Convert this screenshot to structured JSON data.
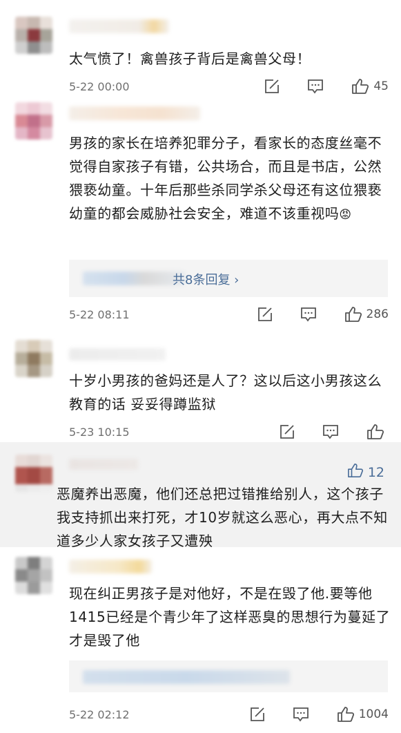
{
  "comments": [
    {
      "text": "太气愤了！禽兽孩子背后是禽兽父母！",
      "time": "5-22 00:00",
      "likes": "45"
    },
    {
      "text": "男孩的家长在培养犯罪分子，看家长的态度丝毫不觉得自家孩子有错，公共场合，而且是书店，公然猥亵幼童。十年后那些杀同学杀父母还有这位猥亵幼童的都会威胁社会安全，难道不该重视吗",
      "emoji": "😡",
      "replies_label": "共8条回复 ›",
      "time": "5-22 08:11",
      "likes": "286"
    },
    {
      "text": "十岁小男孩的爸妈还是人了？这以后这小男孩这么教育的话 妥妥得蹲监狱",
      "time": "5-23 10:15",
      "likes": ""
    },
    {
      "text": "恶魔养出恶魔，他们还总把过错推给别人，这个孩子我支持抓出来打死，才10岁就这么恶心，再大点不知道多少人家女孩子又遭殃",
      "likes": "12"
    },
    {
      "text": "现在纠正男孩子是对他好，不是在毁了他.要等他1415已经是个青少年了这样恶臭的思想行为蔓延了才是毁了他",
      "time": "5-22 02:12",
      "likes": "1004"
    }
  ],
  "icons": {
    "repost": "repost-icon",
    "comment": "comment-icon",
    "like": "thumbs-up-icon"
  },
  "colors": {
    "link": "#4a6d98",
    "meta": "#6f6f6f",
    "shaded_bg": "#f2f2f2"
  }
}
